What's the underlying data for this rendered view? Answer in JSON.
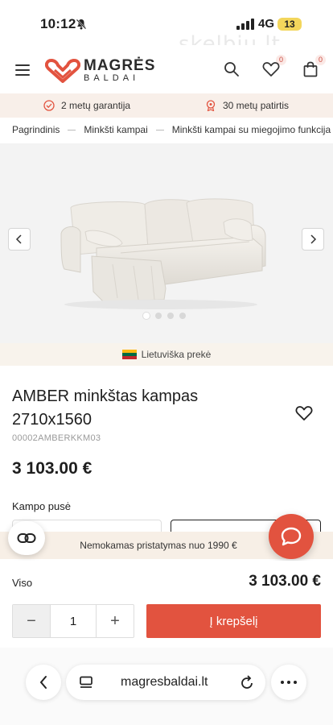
{
  "status_bar": {
    "time": "10:12",
    "network": "4G",
    "battery": "13"
  },
  "watermark": "skelbiu.lt",
  "header": {
    "logo_name": "MAGRĖS",
    "logo_sub": "BALDAI",
    "wishlist_count": "0",
    "cart_count": "0"
  },
  "benefits": [
    {
      "icon": "check-badge-icon",
      "label": "2 metų garantija"
    },
    {
      "icon": "award-icon",
      "label": "30 metų patirtis"
    }
  ],
  "breadcrumbs": [
    "Pagrindinis",
    "Minkšti kampai",
    "Minkšti kampai su miegojimo funkcija"
  ],
  "gallery": {
    "slides": 4,
    "active_slide": 1
  },
  "origin_label": "Lietuviška prekė",
  "product": {
    "title": "AMBER minkštas kampas 2710x1560",
    "sku": "00002AMBERKKM03",
    "price": "3 103.00 €",
    "option_label": "Kampo pusė"
  },
  "delivery_banner": "Nemokamas pristatymas nuo 1990 €",
  "purchase": {
    "total_label": "Viso",
    "total_value": "3 103.00 €",
    "quantity": "1",
    "minus": "−",
    "plus": "+",
    "add_to_cart": "Į krepšelį"
  },
  "browser": {
    "url": "magresbaldai.lt"
  },
  "colors": {
    "accent": "#e2533f",
    "strip": "#f8efe9",
    "text": "#1e1e1e"
  }
}
